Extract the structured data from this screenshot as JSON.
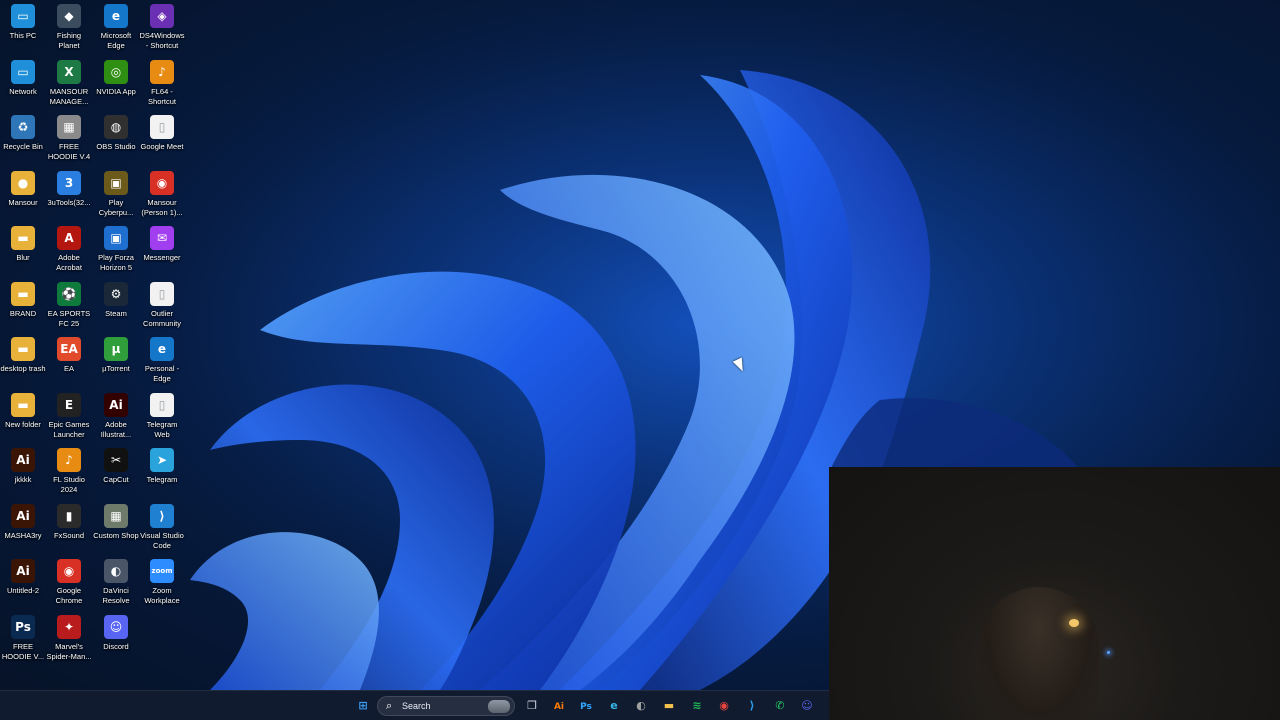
{
  "desktop": {
    "icons": [
      {
        "label": "This PC",
        "icon": "monitor-icon",
        "glyph": "▭",
        "color": "#1e8fd8"
      },
      {
        "label": "Network",
        "icon": "network-icon",
        "glyph": "▭",
        "color": "#1e8fd8"
      },
      {
        "label": "Recycle Bin",
        "icon": "recycle-bin-icon",
        "glyph": "♻",
        "color": "#2f76b8"
      },
      {
        "label": "Mansour",
        "icon": "user-folder-icon",
        "glyph": "●",
        "color": "#e8b23a"
      },
      {
        "label": "Blur",
        "icon": "folder-icon",
        "glyph": "▬",
        "color": "#e8b23a"
      },
      {
        "label": "BRAND",
        "icon": "folder-icon",
        "glyph": "▬",
        "color": "#e8b23a"
      },
      {
        "label": "desktop trash",
        "icon": "folder-icon",
        "glyph": "▬",
        "color": "#e8b23a"
      },
      {
        "label": "New folder",
        "icon": "folder-icon",
        "glyph": "▬",
        "color": "#e8b23a"
      },
      {
        "label": "jkkkk",
        "icon": "illustrator-file-icon",
        "glyph": "Ai",
        "color": "#3a1506"
      },
      {
        "label": "MASHA3ry",
        "icon": "illustrator-file-icon",
        "glyph": "Ai",
        "color": "#3a1506"
      },
      {
        "label": "Untitled-2",
        "icon": "illustrator-file-icon",
        "glyph": "Ai",
        "color": "#3a1506"
      },
      {
        "label": "FREE HOODIE V...",
        "icon": "photoshop-file-icon",
        "glyph": "Ps",
        "color": "#0b2a52"
      },
      {
        "label": "Fishing Planet",
        "icon": "game-icon",
        "glyph": "◆",
        "color": "#3b4c5e"
      },
      {
        "label": "MANSOUR MANAGE...",
        "icon": "excel-file-icon",
        "glyph": "X",
        "color": "#1d7a44"
      },
      {
        "label": "FREE HOODIE V.4",
        "icon": "image-file-icon",
        "glyph": "▦",
        "color": "#8a8a8a"
      },
      {
        "label": "3uTools(32...",
        "icon": "3utools-icon",
        "glyph": "3",
        "color": "#2a7ee0"
      },
      {
        "label": "Adobe Acrobat",
        "icon": "acrobat-icon",
        "glyph": "A",
        "color": "#b3170f"
      },
      {
        "label": "EA SPORTS FC 25",
        "icon": "fc25-icon",
        "glyph": "⚽",
        "color": "#0e7a3c"
      },
      {
        "label": "EA",
        "icon": "ea-icon",
        "glyph": "EA",
        "color": "#e14b2c"
      },
      {
        "label": "Epic Games Launcher",
        "icon": "epic-games-icon",
        "glyph": "E",
        "color": "#222222"
      },
      {
        "label": "FL Studio 2024",
        "icon": "fl-studio-icon",
        "glyph": "♪",
        "color": "#e88b12"
      },
      {
        "label": "FxSound",
        "icon": "fxsound-icon",
        "glyph": "▮",
        "color": "#2b2b2b"
      },
      {
        "label": "Google Chrome",
        "icon": "chrome-icon",
        "glyph": "◉",
        "color": "#d93025"
      },
      {
        "label": "Marvel's Spider-Man...",
        "icon": "spiderman-icon",
        "glyph": "✦",
        "color": "#b81c1c"
      },
      {
        "label": "Microsoft Edge",
        "icon": "edge-icon",
        "glyph": "e",
        "color": "#1577c9"
      },
      {
        "label": "NVIDIA App",
        "icon": "nvidia-icon",
        "glyph": "◎",
        "color": "#2f8f12"
      },
      {
        "label": "OBS Studio",
        "icon": "obs-icon",
        "glyph": "◍",
        "color": "#303030"
      },
      {
        "label": "Play Cyberpu...",
        "icon": "cyberpunk-icon",
        "glyph": "▣",
        "color": "#6b5a1a"
      },
      {
        "label": "Play Forza Horizon 5",
        "icon": "forza-icon",
        "glyph": "▣",
        "color": "#1e6fd0"
      },
      {
        "label": "Steam",
        "icon": "steam-icon",
        "glyph": "⚙",
        "color": "#1b2838"
      },
      {
        "label": "µTorrent",
        "icon": "utorrent-icon",
        "glyph": "µ",
        "color": "#2f9e3b"
      },
      {
        "label": "Adobe Illustrat...",
        "icon": "illustrator-icon",
        "glyph": "Ai",
        "color": "#330000"
      },
      {
        "label": "CapCut",
        "icon": "capcut-icon",
        "glyph": "✂",
        "color": "#111111"
      },
      {
        "label": "Custom Shop",
        "icon": "custom-shop-icon",
        "glyph": "▦",
        "color": "#6e7a6a"
      },
      {
        "label": "DaVinci Resolve",
        "icon": "davinci-icon",
        "glyph": "◐",
        "color": "#4a5568"
      },
      {
        "label": "Discord",
        "icon": "discord-icon",
        "glyph": "☺",
        "color": "#5865f2"
      },
      {
        "label": "DS4Windows - Shortcut",
        "icon": "ds4windows-icon",
        "glyph": "◈",
        "color": "#6b2fb3"
      },
      {
        "label": "FL64 - Shortcut",
        "icon": "fl-studio-icon",
        "glyph": "♪",
        "color": "#e88b12"
      },
      {
        "label": "Google Meet",
        "icon": "file-icon",
        "glyph": "▯",
        "color": "#f2f2f2"
      },
      {
        "label": "Mansour (Person 1)...",
        "icon": "chrome-icon",
        "glyph": "◉",
        "color": "#d93025"
      },
      {
        "label": "Messenger",
        "icon": "messenger-icon",
        "glyph": "✉",
        "color": "#a13ff0"
      },
      {
        "label": "Outlier Community",
        "icon": "file-icon",
        "glyph": "▯",
        "color": "#f2f2f2"
      },
      {
        "label": "Personal - Edge",
        "icon": "edge-icon",
        "glyph": "e",
        "color": "#1577c9"
      },
      {
        "label": "Telegram Web",
        "icon": "file-icon",
        "glyph": "▯",
        "color": "#f2f2f2"
      },
      {
        "label": "Telegram",
        "icon": "telegram-icon",
        "glyph": "➤",
        "color": "#2aa3dc"
      },
      {
        "label": "Visual Studio Code",
        "icon": "vscode-icon",
        "glyph": "⟩",
        "color": "#1f7fd0"
      },
      {
        "label": "Zoom Workplace",
        "icon": "zoom-icon",
        "glyph": "zoom",
        "color": "#2d8cff"
      }
    ]
  },
  "taskbar": {
    "search_placeholder": "Search",
    "items": [
      {
        "name": "start-button",
        "icon": "windows-icon",
        "glyph": "⊞",
        "color": "#3b9ff5"
      },
      {
        "name": "task-view-button",
        "icon": "task-view-icon",
        "glyph": "❐",
        "color": "#cfd6e0"
      },
      {
        "name": "taskbar-illustrator",
        "icon": "illustrator-icon",
        "glyph": "Ai",
        "color": "#ff7c00"
      },
      {
        "name": "taskbar-photoshop",
        "icon": "photoshop-icon",
        "glyph": "Ps",
        "color": "#31a8ff"
      },
      {
        "name": "taskbar-edge",
        "icon": "edge-icon",
        "glyph": "e",
        "color": "#36b6e8"
      },
      {
        "name": "taskbar-davinci",
        "icon": "davinci-icon",
        "glyph": "◐",
        "color": "#a0a0a0"
      },
      {
        "name": "taskbar-file-explorer",
        "icon": "folder-icon",
        "glyph": "▬",
        "color": "#f2c14e"
      },
      {
        "name": "taskbar-spotify",
        "icon": "spotify-icon",
        "glyph": "≋",
        "color": "#1db954"
      },
      {
        "name": "taskbar-chrome",
        "icon": "chrome-icon",
        "glyph": "◉",
        "color": "#e8453c"
      },
      {
        "name": "taskbar-vscode",
        "icon": "vscode-icon",
        "glyph": "⟩",
        "color": "#2f9ef0"
      },
      {
        "name": "taskbar-whatsapp",
        "icon": "whatsapp-icon",
        "glyph": "✆",
        "color": "#25d366"
      },
      {
        "name": "taskbar-discord",
        "icon": "discord-icon",
        "glyph": "☺",
        "color": "#5865f2"
      }
    ]
  }
}
